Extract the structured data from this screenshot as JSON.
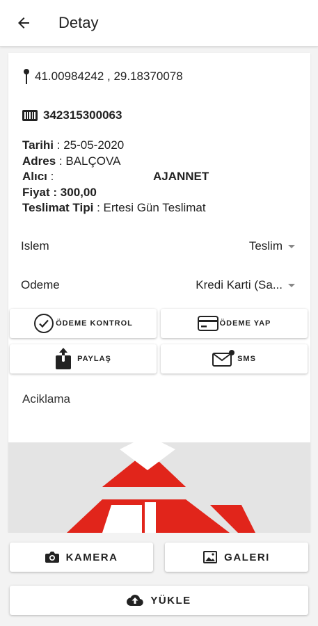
{
  "header": {
    "title": "Detay"
  },
  "location": {
    "coordinates": "41.00984242 , 29.18370078"
  },
  "shipment": {
    "barcode": "342315300063",
    "date_label": "Tarihi",
    "date_value": " : 25-05-2020",
    "address_label": "Adres",
    "address_value": " : BALÇOVA",
    "receiver_label": "Alıcı",
    "receiver_sep": " :",
    "receiver_value": "AJANNET",
    "price_text": "Fiyat : 300,00",
    "delivery_label": "Teslimat Tipi",
    "delivery_value": " : Ertesi Gün Teslimat"
  },
  "islem": {
    "label": "Islem",
    "selected": "Teslim"
  },
  "odeme": {
    "label": "Odeme",
    "selected": "Kredi Karti (Sa..."
  },
  "actions": {
    "payment_check": "ÖDEME KONTROL",
    "make_payment": "ÖDEME YAP",
    "share": "PAYLAŞ",
    "sms": "SMS"
  },
  "notes": {
    "label": "Aciklama"
  },
  "bottom": {
    "camera": "KAMERA",
    "gallery": "GALERI",
    "upload": "YÜKLE"
  },
  "colors": {
    "logo_red": "#e1251b",
    "accent_dark": "#222222"
  },
  "icons": {
    "back": "arrow-left-icon",
    "pin": "map-pin-icon",
    "barcode": "barcode-icon",
    "check": "check-circle-icon",
    "card": "credit-card-icon",
    "share": "share-icon",
    "sms": "message-icon",
    "camera": "camera-icon",
    "gallery": "image-icon",
    "upload": "cloud-upload-icon"
  }
}
